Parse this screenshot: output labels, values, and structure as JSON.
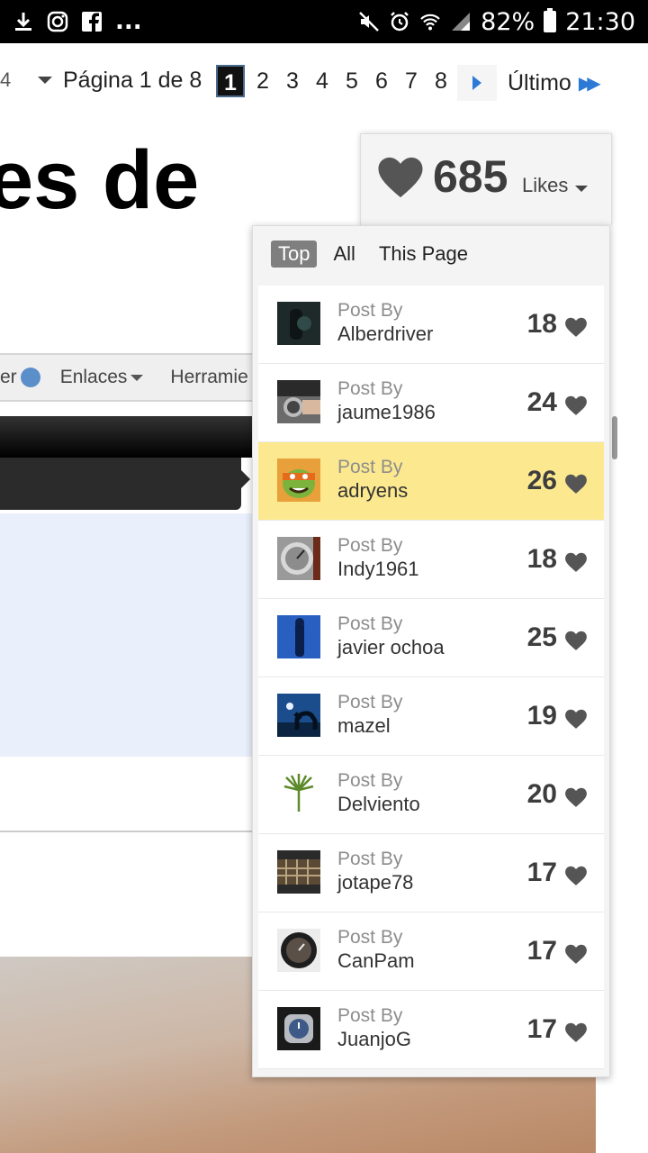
{
  "statusbar": {
    "more": "...",
    "battery": "82%",
    "time": "21:30"
  },
  "pagination": {
    "cut_left": "4",
    "page_label": "Página 1 de 8",
    "pages": [
      "1",
      "2",
      "3",
      "4",
      "5",
      "6",
      "7",
      "8"
    ],
    "current": "1",
    "last_label": "Último"
  },
  "page": {
    "title_fragment": "es de",
    "nav_items": [
      "er",
      "Enlaces",
      "Herramie"
    ]
  },
  "likes": {
    "count": "685",
    "label": "Likes",
    "tabs": [
      "Top",
      "All",
      "This Page"
    ],
    "active_tab": "Top",
    "entries": [
      {
        "post_by": "Post By",
        "user": "Alberdriver",
        "count": "18",
        "avatar": "dark-watch"
      },
      {
        "post_by": "Post By",
        "user": "jaume1986",
        "count": "24",
        "avatar": "wrist-watch"
      },
      {
        "post_by": "Post By",
        "user": "adryens",
        "count": "26",
        "avatar": "ninja-turtle",
        "highlight": true
      },
      {
        "post_by": "Post By",
        "user": "Indy1961",
        "count": "18",
        "avatar": "watch-face"
      },
      {
        "post_by": "Post By",
        "user": "javier ochoa",
        "count": "25",
        "avatar": "blue-figure"
      },
      {
        "post_by": "Post By",
        "user": "mazel",
        "count": "19",
        "avatar": "horse-night"
      },
      {
        "post_by": "Post By",
        "user": "Delviento",
        "count": "20",
        "avatar": "palm-leaf"
      },
      {
        "post_by": "Post By",
        "user": "jotape78",
        "count": "17",
        "avatar": "aerial-city"
      },
      {
        "post_by": "Post By",
        "user": "CanPam",
        "count": "17",
        "avatar": "black-watch"
      },
      {
        "post_by": "Post By",
        "user": "JuanjoG",
        "count": "17",
        "avatar": "steel-watch"
      }
    ]
  },
  "colors": {
    "highlight": "#fce98f",
    "accent_blue": "#2d7ad6",
    "heart": "#555555"
  }
}
